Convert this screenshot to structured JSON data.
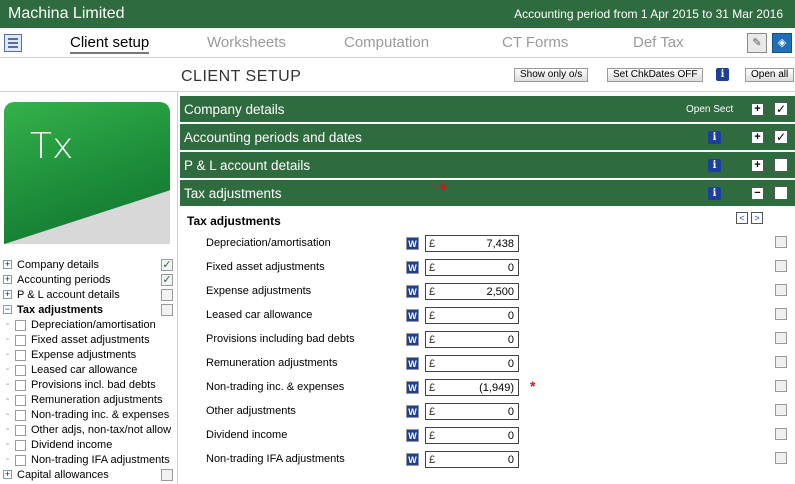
{
  "titlebar": {
    "app_title": "Machina Limited",
    "period": "Accounting period from 1 Apr 2015 to 31 Mar 2016"
  },
  "nav": {
    "tabs": [
      {
        "label": "Client setup",
        "active": true
      },
      {
        "label": "Worksheets",
        "active": false
      },
      {
        "label": "Computation",
        "active": false
      },
      {
        "label": "CT Forms",
        "active": false
      },
      {
        "label": "Def Tax",
        "active": false
      }
    ],
    "icons": [
      "list-icon",
      "edit-pen-icon",
      "tax-return-icon"
    ]
  },
  "header": {
    "title": "CLIENT SETUP",
    "show_only_label": "Show only o/s",
    "set_chkdates_label": "Set ChkDates OFF",
    "info_glyph": "i",
    "open_all_label": "Open all"
  },
  "logo": {
    "text": "Tx",
    "colors": {
      "green": "#2ea044",
      "grey": "#d8d8d8"
    }
  },
  "tree": {
    "items": [
      {
        "label": "Company details",
        "expander": "+",
        "checked": true,
        "bold": false
      },
      {
        "label": "Accounting periods",
        "expander": "+",
        "checked": true,
        "bold": false
      },
      {
        "label": "P & L account details",
        "expander": "+",
        "checked": false,
        "bold": false
      },
      {
        "label": "Tax adjustments",
        "expander": "−",
        "checked": false,
        "bold": true
      }
    ],
    "subitems": [
      "Depreciation/amortisation",
      "Fixed asset adjustments",
      "Expense adjustments",
      "Leased car allowance",
      "Provisions incl. bad debts",
      "Remuneration adjustments",
      "Non-trading inc. & expenses",
      "Other adjs, non-tax/not allow",
      "Dividend income",
      "Non-trading IFA adjustments"
    ],
    "after": [
      {
        "label": "Capital allowances",
        "expander": "+",
        "checked": false
      }
    ]
  },
  "sections": [
    {
      "title": "Company details",
      "open_sect": "Open Sect",
      "info": false,
      "expander": "+",
      "checked": true,
      "asterisk": false
    },
    {
      "title": "Accounting periods and dates",
      "open_sect": "",
      "info": true,
      "expander": "+",
      "checked": true,
      "asterisk": false
    },
    {
      "title": "P & L account details",
      "open_sect": "",
      "info": true,
      "expander": "+",
      "checked": false,
      "asterisk": false
    },
    {
      "title": "Tax adjustments",
      "open_sect": "",
      "info": true,
      "expander": "−",
      "checked": false,
      "asterisk": true
    }
  ],
  "tax_adjustments": {
    "header": "Tax adjustments",
    "prev_glyph": "<",
    "next_glyph": ">",
    "w_glyph": "W",
    "currency": "£",
    "asterisk_glyph": "*",
    "rows": [
      {
        "label": "Depreciation/amortisation",
        "value": "7,438",
        "asterisk": false
      },
      {
        "label": "Fixed asset adjustments",
        "value": "0",
        "asterisk": false
      },
      {
        "label": "Expense adjustments",
        "value": "2,500",
        "asterisk": false
      },
      {
        "label": "Leased car allowance",
        "value": "0",
        "asterisk": false
      },
      {
        "label": "Provisions including bad debts",
        "value": "0",
        "asterisk": false
      },
      {
        "label": "Remuneration adjustments",
        "value": "0",
        "asterisk": false
      },
      {
        "label": "Non-trading inc. & expenses",
        "value": "(1,949)",
        "asterisk": true
      },
      {
        "label": "Other adjustments",
        "value": "0",
        "asterisk": false
      },
      {
        "label": "Dividend income",
        "value": "0",
        "asterisk": false
      },
      {
        "label": "Non-trading IFA adjustments",
        "value": "0",
        "asterisk": false
      }
    ]
  },
  "colors": {
    "accent_green": "#2e6b3e",
    "info_blue": "#1c3f9e",
    "asterisk_red": "#dd1111"
  }
}
